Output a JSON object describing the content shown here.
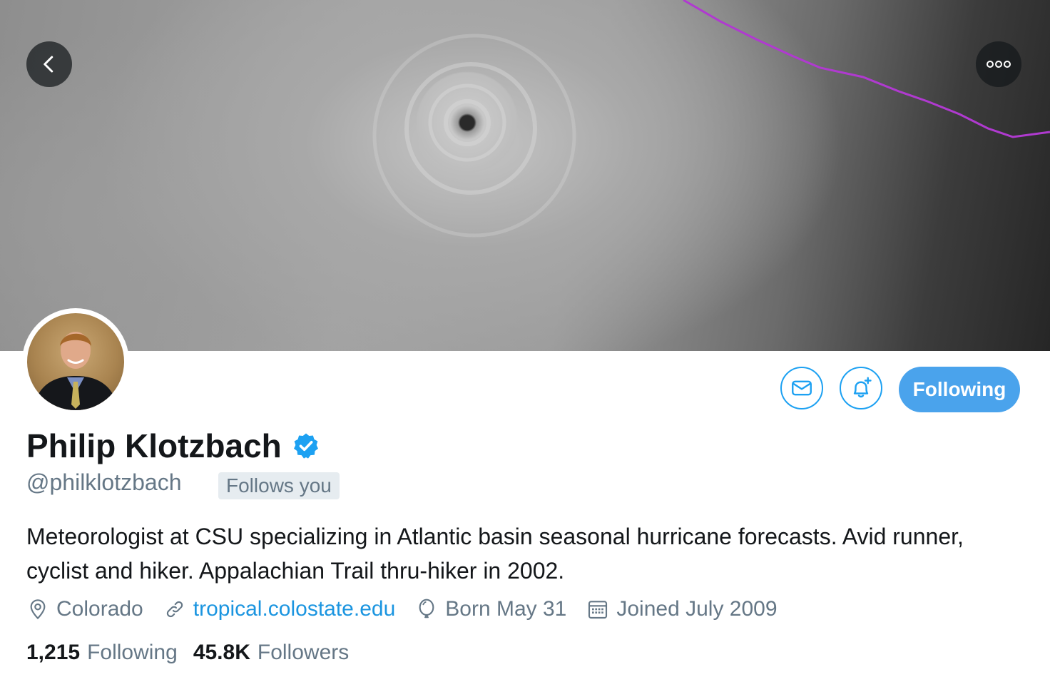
{
  "profile": {
    "name": "Philip Klotzbach",
    "handle": "@philklotzbach",
    "follows_you": "Follows you",
    "bio": "Meteorologist at CSU specializing in Atlantic basin seasonal hurricane forecasts. Avid runner, cyclist and hiker. Appalachian Trail thru-hiker in 2002.",
    "location": "Colorado",
    "website": "tropical.colostate.edu",
    "birthday": "Born May 31",
    "joined": "Joined July 2009"
  },
  "stats": {
    "following_count": "1,215",
    "following_label": "Following",
    "followers_count": "45.8K",
    "followers_label": "Followers"
  },
  "actions": {
    "following_button": "Following"
  },
  "icons": {
    "back": "chevron-left-icon",
    "more": "more-icon",
    "message": "envelope-icon",
    "notify": "bell-plus-icon",
    "verified": "verified-badge-icon",
    "location": "location-pin-icon",
    "link": "link-icon",
    "birthday": "balloon-icon",
    "calendar": "calendar-icon"
  },
  "colors": {
    "accent": "#1da1f2",
    "following_button": "#4aa3ec",
    "secondary_text": "#657786",
    "storm_track": "#b03ad0"
  }
}
